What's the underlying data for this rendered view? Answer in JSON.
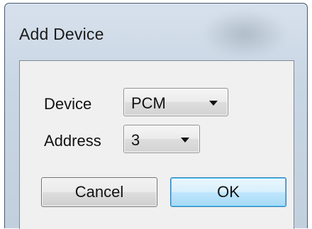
{
  "dialog": {
    "title": "Add Device"
  },
  "form": {
    "device_label": "Device",
    "device_value": "PCM",
    "address_label": "Address",
    "address_value": "3"
  },
  "buttons": {
    "cancel_label": "Cancel",
    "ok_label": "OK"
  },
  "icons": {
    "dropdown": "chevron-down-icon"
  }
}
